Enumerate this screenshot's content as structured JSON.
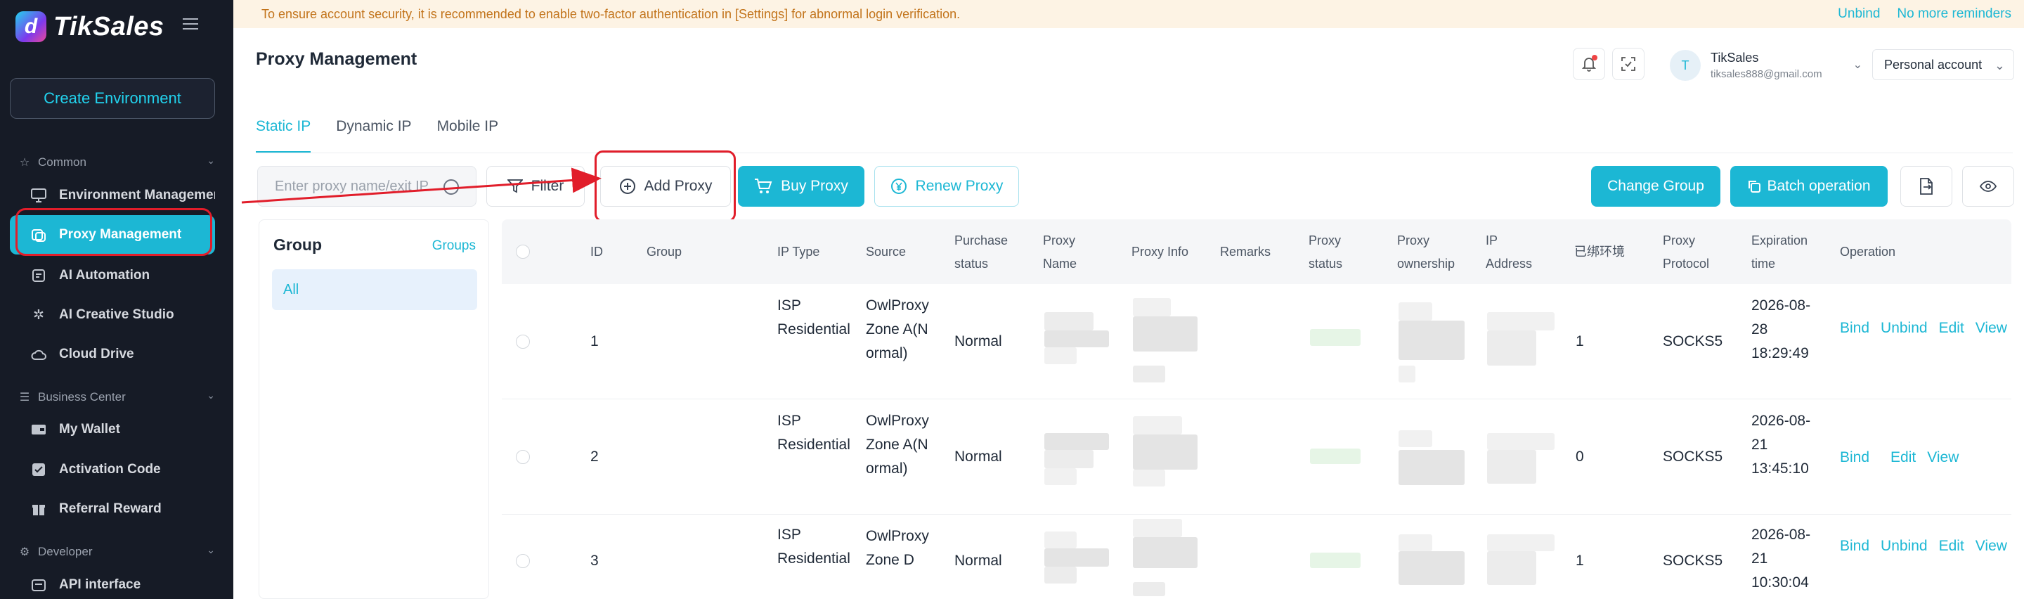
{
  "app": {
    "name": "TikSales",
    "logo_glyph": "d",
    "accent_color": "#1cb7d4",
    "sidebar_bg": "#161b26"
  },
  "sidebar": {
    "create_button": "Create Environment",
    "sections": [
      {
        "label": "Common",
        "icon": "star-icon",
        "items": [
          {
            "label": "Environment Management",
            "icon": "monitor-icon"
          },
          {
            "label": "Proxy Management",
            "icon": "proxy-icon",
            "active": true
          },
          {
            "label": "AI Automation",
            "icon": "robot-icon"
          },
          {
            "label": "AI Creative Studio",
            "icon": "sparkle-icon"
          },
          {
            "label": "Cloud Drive",
            "icon": "cloud-icon"
          }
        ]
      },
      {
        "label": "Business Center",
        "icon": "database-icon",
        "items": [
          {
            "label": "My Wallet",
            "icon": "wallet-icon"
          },
          {
            "label": "Activation Code",
            "icon": "code-icon"
          },
          {
            "label": "Referral Reward",
            "icon": "gift-icon"
          }
        ]
      },
      {
        "label": "Developer",
        "icon": "developer-icon",
        "items": [
          {
            "label": "API interface",
            "icon": "api-icon"
          }
        ]
      }
    ]
  },
  "banner": {
    "message": "To ensure account security, it is recommended to enable two-factor authentication in [Settings] for abnormal login verification.",
    "unbind": "Unbind",
    "no_more": "No more reminders"
  },
  "header": {
    "title": "Proxy Management",
    "user": {
      "initial": "T",
      "name": "TikSales",
      "email": "tiksales888@gmail.com"
    },
    "account": "Personal account"
  },
  "tabs": [
    {
      "label": "Static IP",
      "active": true
    },
    {
      "label": "Dynamic IP"
    },
    {
      "label": "Mobile IP"
    }
  ],
  "toolbar": {
    "search_placeholder": "Enter proxy name/exit IP",
    "filter": "Filter",
    "add_proxy": "Add Proxy",
    "buy_proxy": "Buy Proxy",
    "renew_proxy": "Renew Proxy",
    "change_group": "Change Group",
    "batch_operation": "Batch operation"
  },
  "group_panel": {
    "title": "Group",
    "link": "Groups",
    "items": [
      "All"
    ]
  },
  "table": {
    "columns": [
      "ID",
      "Group",
      "IP Type",
      "Source",
      "Purchase status",
      "Proxy Name",
      "Proxy Info",
      "Remarks",
      "Proxy status",
      "Proxy ownership",
      "IP Address",
      "已绑环境",
      "Proxy Protocol",
      "Expiration time",
      "Operation"
    ],
    "rows": [
      {
        "id": "1",
        "group": "",
        "ip_type": "ISP Residential",
        "source": "OwlProxy Zone A(Normal)",
        "purchase_status": "Normal",
        "bound": "1",
        "protocol": "SOCKS5",
        "expiration": "2026-08-28 18:29:49",
        "ops": [
          "Bind",
          "Unbind",
          "Edit",
          "View"
        ]
      },
      {
        "id": "2",
        "group": "",
        "ip_type": "ISP Residential",
        "source": "OwlProxy Zone A(Normal)",
        "purchase_status": "Normal",
        "bound": "0",
        "protocol": "SOCKS5",
        "expiration": "2026-08-21 13:45:10",
        "ops": [
          "Bind",
          "Edit",
          "View"
        ]
      },
      {
        "id": "3",
        "group": "",
        "ip_type": "ISP Residential",
        "source": "OwlProxy Zone D",
        "purchase_status": "Normal",
        "bound": "1",
        "protocol": "SOCKS5",
        "expiration": "2026-08-21 10:30:04",
        "ops": [
          "Bind",
          "Unbind",
          "Edit",
          "View"
        ]
      }
    ]
  }
}
